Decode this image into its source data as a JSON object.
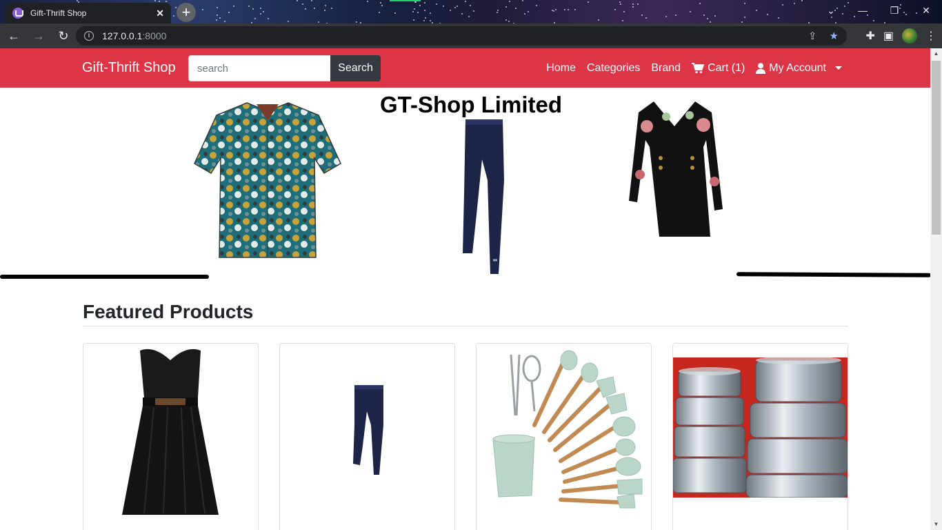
{
  "browser": {
    "tab_title": "Gift-Thrift Shop",
    "url_host": "127.0.0.1",
    "url_port": ":8000"
  },
  "navbar": {
    "brand": "Gift-Thrift Shop",
    "search_placeholder": "search",
    "search_button": "Search",
    "links": {
      "home": "Home",
      "categories": "Categories",
      "brand": "Brand",
      "cart": "Cart (1)",
      "account": "My Account"
    }
  },
  "hero": {
    "title": "GT-Shop Limited"
  },
  "featured": {
    "title": "Featured Products"
  },
  "colors": {
    "navbar": "#dc3545",
    "search_button": "#343a40"
  }
}
